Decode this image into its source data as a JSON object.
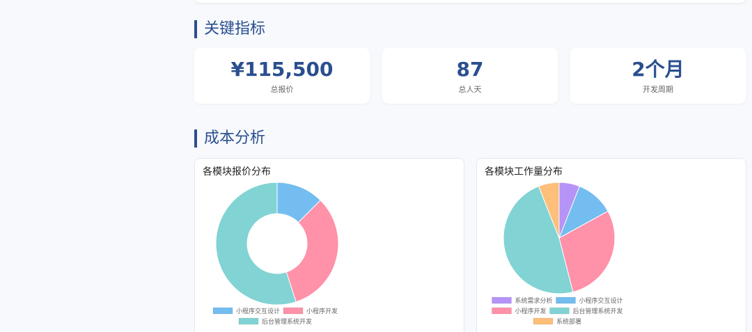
{
  "sections": {
    "kpi_title": "关键指标",
    "cost_title": "成本分析"
  },
  "kpis": [
    {
      "value": "¥115,500",
      "label": "总报价"
    },
    {
      "value": "87",
      "label": "总人天"
    },
    {
      "value": "2个月",
      "label": "开发周期"
    }
  ],
  "chart_data": [
    {
      "type": "pie",
      "title": "各模块报价分布",
      "donut": true,
      "legend_position": "bottom",
      "slices": [
        {
          "label": "小程序交互设计",
          "value": 12.5,
          "color": "#74bdf0"
        },
        {
          "label": "小程序开发",
          "value": 32.5,
          "color": "#ff91a8"
        },
        {
          "label": "后台管理系统开发",
          "value": 55.0,
          "color": "#82d3d3"
        }
      ]
    },
    {
      "type": "pie",
      "title": "各模块工作量分布",
      "donut": false,
      "legend_position": "bottom",
      "slices": [
        {
          "label": "系统需求分析",
          "value": 6,
          "color": "#b693f7"
        },
        {
          "label": "小程序交互设计",
          "value": 11,
          "color": "#74bdf0"
        },
        {
          "label": "小程序开发",
          "value": 29,
          "color": "#ff91a8"
        },
        {
          "label": "后台管理系统开发",
          "value": 48,
          "color": "#82d3d3"
        },
        {
          "label": "系统部署",
          "value": 6,
          "color": "#fdbf7a"
        }
      ]
    }
  ]
}
